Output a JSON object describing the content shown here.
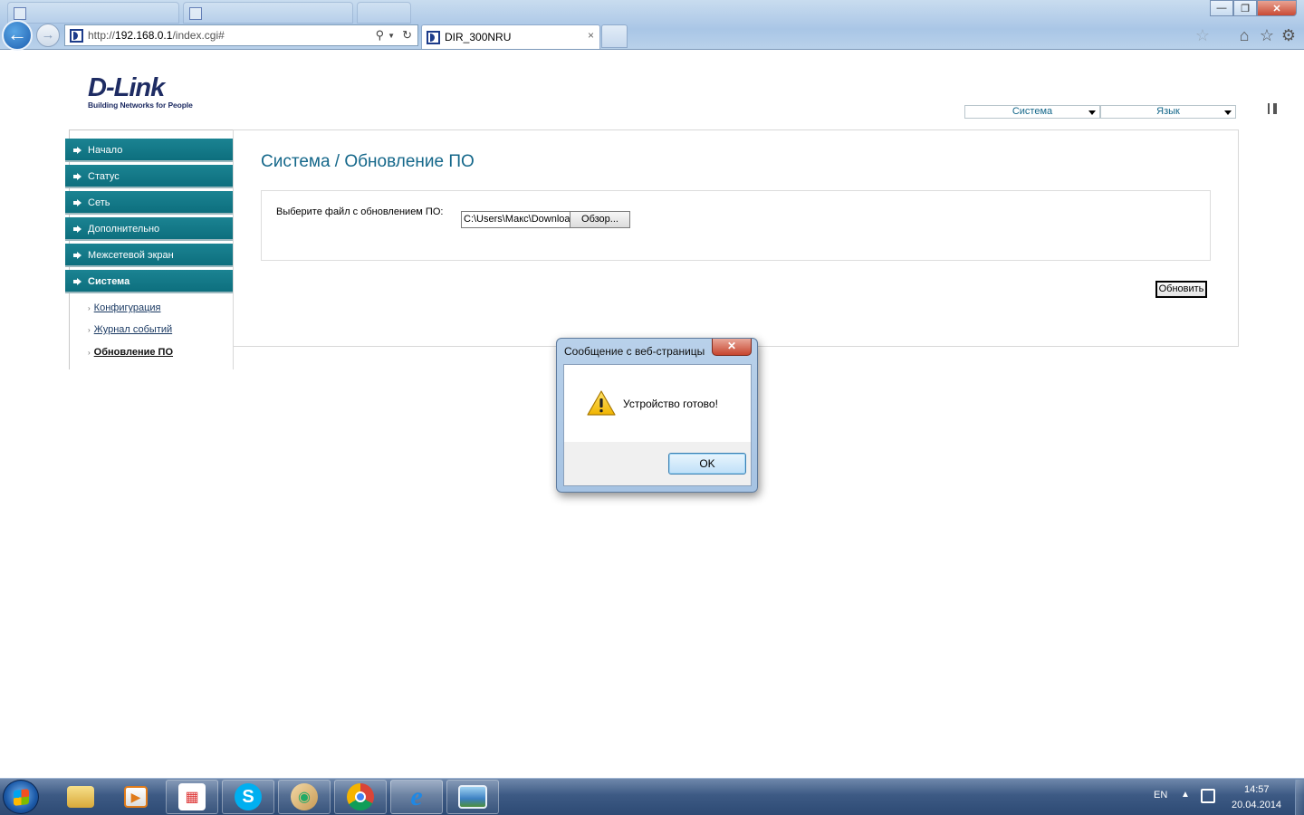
{
  "browser": {
    "url_prefix": "http://",
    "url_host": "192.168.0.1",
    "url_path": "/index.cgi#",
    "tab_title": "DIR_300NRU",
    "tab_close": "×",
    "window_controls": {
      "minimize": "—",
      "restore": "❐",
      "close": "✕"
    }
  },
  "header": {
    "logo_word": "D-Link",
    "logo_tagline": "Building Networks for People",
    "system_select": "Система",
    "language_select": "Язык"
  },
  "sidebar": {
    "items": [
      {
        "label": "Начало"
      },
      {
        "label": "Статус"
      },
      {
        "label": "Сеть"
      },
      {
        "label": "Дополнительно"
      },
      {
        "label": "Межсетевой экран"
      },
      {
        "label": "Система"
      }
    ],
    "subitems": [
      {
        "label": "Конфигурация"
      },
      {
        "label": "Журнал событий"
      },
      {
        "label": "Обновление ПО"
      }
    ]
  },
  "main": {
    "title": "Система / Обновление ПО",
    "file_label": "Выберите файл с обновлением ПО:",
    "file_path": "C:\\Users\\Макс\\Downloa",
    "browse_label": "Обзор...",
    "update_label": "Обновить"
  },
  "dialog": {
    "title": "Сообщение с веб-страницы",
    "close": "✕",
    "message": "Устройство готово!",
    "ok_label": "OK"
  },
  "taskbar": {
    "language": "EN",
    "time": "14:57",
    "date": "20.04.2014"
  },
  "colors": {
    "nav_bg": "#0d6f7e",
    "title_color": "#14678a",
    "logo_color": "#1e2c63"
  }
}
